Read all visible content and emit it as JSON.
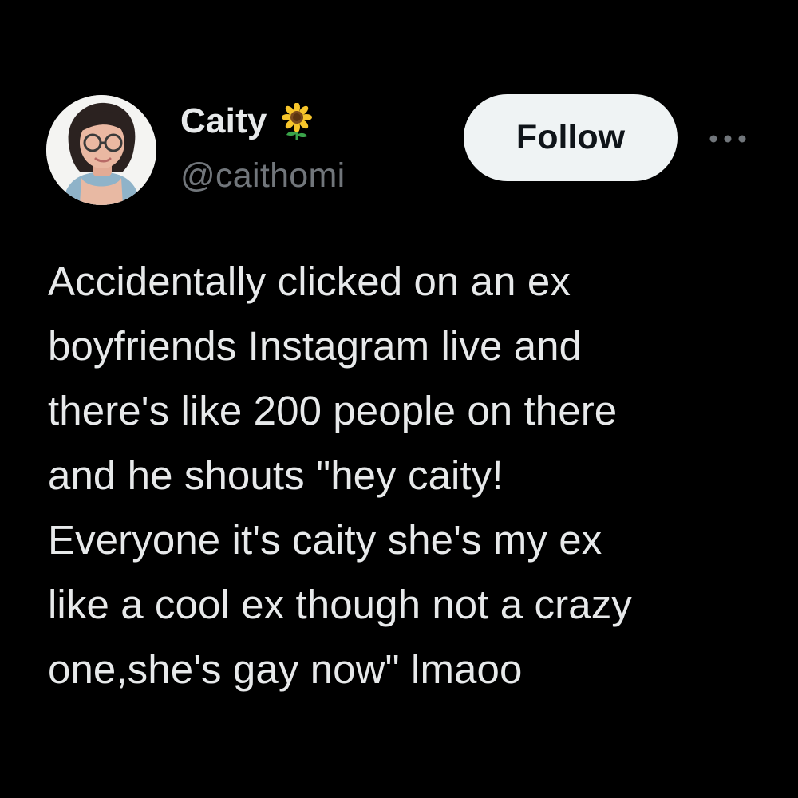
{
  "author": {
    "display_name": "Caity",
    "name_emoji": "sunflower-icon",
    "handle": "@caithomi",
    "avatar": "avatar-photo"
  },
  "actions": {
    "follow_label": "Follow",
    "more_icon": "more-options-icon"
  },
  "tweet": {
    "text": "Accidentally clicked on an ex\nboyfriends Instagram live and\nthere's like 200 people on there\nand he shouts \"hey caity!\nEveryone it's caity she's my ex\nlike a cool ex though not a crazy\none,she's gay now\" lmaoo"
  },
  "colors": {
    "background": "#000000",
    "primary_text": "#e7e9ea",
    "secondary_text": "#71767b",
    "follow_bg": "#eff3f4",
    "follow_text": "#0f1419"
  }
}
